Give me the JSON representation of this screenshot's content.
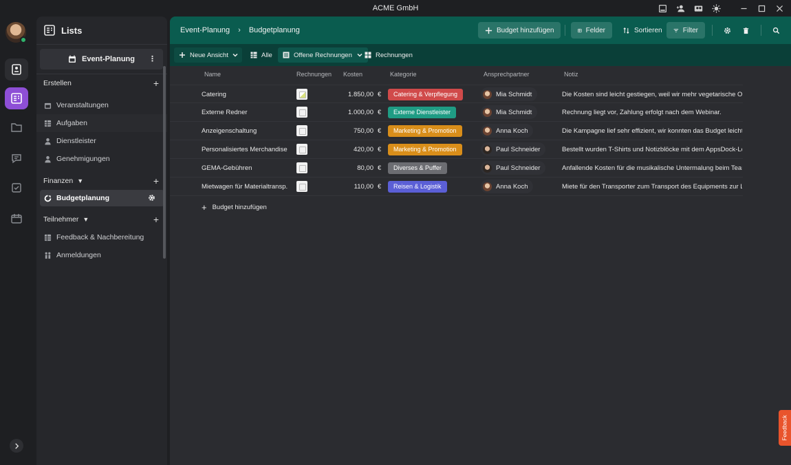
{
  "window": {
    "title": "ACME GmbH"
  },
  "sidebar": {
    "title": "Lists",
    "event_selector": "Event-Planung",
    "sections": [
      {
        "label": "Erstellen",
        "items": [
          "Veranstaltungen",
          "Aufgaben",
          "Dienstleister",
          "Genehmigungen"
        ]
      },
      {
        "label": "Finanzen",
        "items": [
          "Budgetplanung"
        ]
      },
      {
        "label": "Teilnehmer",
        "items": [
          "Feedback & Nachbereitung",
          "Anmeldungen"
        ]
      }
    ]
  },
  "topbar": {
    "breadcrumb": [
      "Event-Planung",
      "Budgetplanung"
    ],
    "add_budget": "Budget hinzufügen",
    "fields": "Felder",
    "sort": "Sortieren",
    "filter": "Filter"
  },
  "viewbar": {
    "new_view": "Neue Ansicht",
    "all": "Alle",
    "open_invoices": "Offene Rechnungen",
    "invoices": "Rechnungen"
  },
  "table": {
    "columns": [
      "Name",
      "Rechnungen",
      "Kosten",
      "Kategorie",
      "Ansprechpartner",
      "Notiz"
    ],
    "currency": "€",
    "rows": [
      {
        "name": "Catering",
        "cost": "1.850,00",
        "category": "Catering & Verpflegung",
        "category_color": "#d04a4a",
        "contact": "Mia Schmidt",
        "note": "Die Kosten sind leicht gestiegen, weil wir mehr vegetarische Opti..."
      },
      {
        "name": "Externe Redner",
        "cost": "1.000,00",
        "category": "Externe Dienstleister",
        "category_color": "#1f9c84",
        "contact": "Mia Schmidt",
        "note": "Rechnung liegt vor, Zahlung erfolgt nach dem Webinar."
      },
      {
        "name": "Anzeigenschaltung",
        "cost": "750,00",
        "category": "Marketing & Promotion",
        "category_color": "#d98e1a",
        "contact": "Anna Koch",
        "note": "Die Kampagne lief sehr effizient, wir konnten das Budget leicht u..."
      },
      {
        "name": "Personalisiertes Merchandise",
        "cost": "420,00",
        "category": "Marketing & Promotion",
        "category_color": "#d98e1a",
        "contact": "Paul Schneider",
        "note": "Bestellt wurden T-Shirts und Notizblöcke mit dem AppsDock-Log..."
      },
      {
        "name": "GEMA-Gebühren",
        "cost": "80,00",
        "category": "Diverses & Puffer",
        "category_color": "#6c6d72",
        "contact": "Paul Schneider",
        "note": "Anfallende Kosten für die musikalische Untermalung beim Team-..."
      },
      {
        "name": "Mietwagen für Materialtransp...",
        "cost": "110,00",
        "category": "Reisen & Logistik",
        "category_color": "#5b5fd6",
        "contact": "Anna Koch",
        "note": "Miete für den Transporter zum Transport des Equipments zur Loc..."
      }
    ],
    "add_row": "Budget hinzufügen"
  },
  "feedback_tab": "Feedback"
}
